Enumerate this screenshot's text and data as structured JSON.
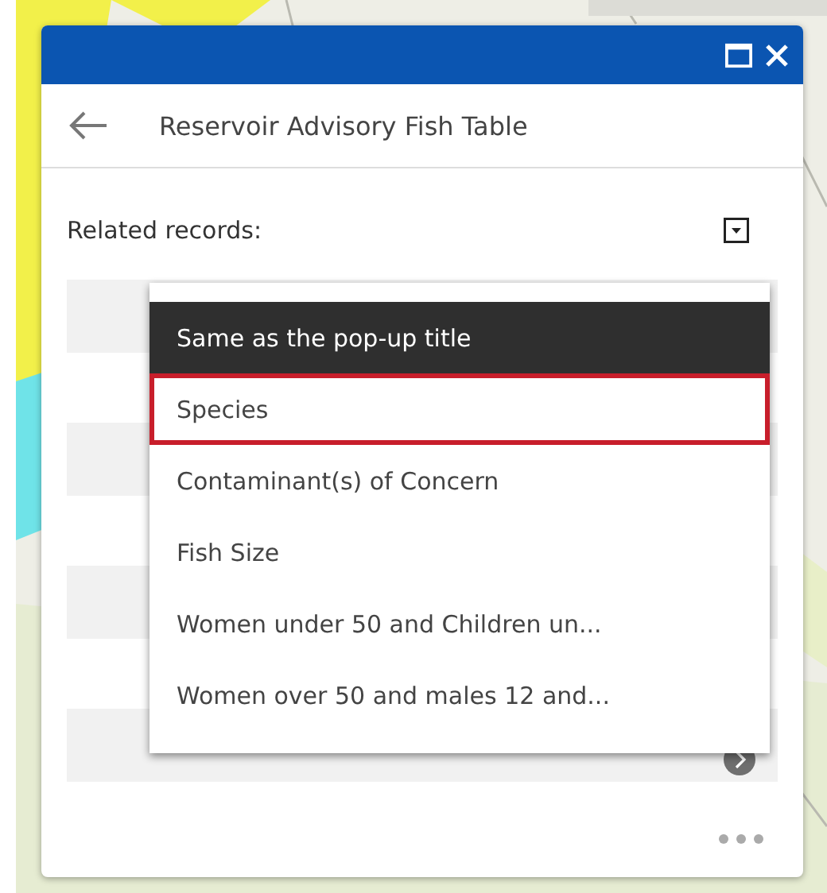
{
  "popup": {
    "title": "Reservoir Advisory Fish Table",
    "related_label": "Related records:",
    "menu": [
      {
        "label": "Same as the pop-up title",
        "selected": true,
        "outlined": false
      },
      {
        "label": "Species",
        "selected": false,
        "outlined": true
      },
      {
        "label": "Contaminant(s) of Concern",
        "selected": false,
        "outlined": false
      },
      {
        "label": "Fish Size",
        "selected": false,
        "outlined": false
      },
      {
        "label": "Women under 50 and Children un...",
        "selected": false,
        "outlined": false
      },
      {
        "label": "Women over 50 and males 12 and...",
        "selected": false,
        "outlined": false
      }
    ]
  }
}
